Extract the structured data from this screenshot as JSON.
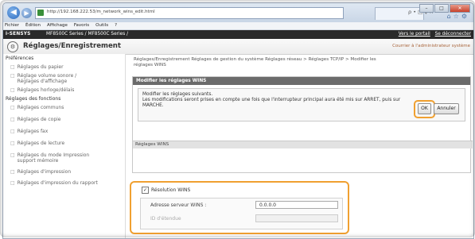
{
  "browser": {
    "url": "http://192.168.222.53/m_network_wins_edit.html",
    "search_controls": "ρ • □ ¢ ×",
    "nav_icons": [
      "arrow-left-icon",
      "arrow-right-icon"
    ],
    "toolbar_icons": [
      "home-icon",
      "star-icon",
      "gear-icon"
    ],
    "menu": [
      "Fichier",
      "Édition",
      "Affichage",
      "Favoris",
      "Outils",
      "?"
    ]
  },
  "device_header": {
    "logo": "i-SENSYS",
    "device": "MF8500C Series / MF8500C Series /",
    "portal_link": "Vers le portail",
    "logout_link": "Se déconnecter"
  },
  "page_header": {
    "title": "Réglages/Enregistrement",
    "admin_link": "Courrier à l'administrateur système"
  },
  "sidebar": {
    "items": [
      {
        "type": "head",
        "label": "Préférences"
      },
      {
        "type": "sub",
        "label": "Réglages du papier"
      },
      {
        "type": "sub",
        "label": "Réglage volume sonore /",
        "label2": "Réglages d'affichage"
      },
      {
        "type": "sub",
        "label": "Réglages horloge/délais"
      },
      {
        "type": "head",
        "label": "Réglages des fonctions"
      },
      {
        "type": "sub",
        "label": "Réglages communs"
      },
      {
        "type": "sub",
        "label": "Réglages de copie"
      },
      {
        "type": "sub",
        "label": "Réglages fax"
      },
      {
        "type": "sub",
        "label": "Réglages de lecture"
      },
      {
        "type": "sub",
        "label": "Réglages du mode Impression",
        "label2": "support mémoire"
      },
      {
        "type": "sub",
        "label": "Réglages d'impression"
      },
      {
        "type": "sub",
        "label": "Réglages d'impression du rapport"
      }
    ]
  },
  "main": {
    "breadcrumb_line1": "Réglages/Enregistrement Réglages de gestion du système Réglages réseau > Réglages TCP/IP > Modifier les",
    "breadcrumb_line2": "réglages WINS",
    "panel_title": "Modifier les réglages WINS",
    "message_line1": "Modifier les réglages suivants.",
    "message_line2": "Les modifications seront prises en compte une fois que l'interrupteur principal aura été mis sur ARRET, puis sur",
    "message_line3": "MARCHE.",
    "ok_label": "OK",
    "cancel_label": "Annuler",
    "section_title": "Réglages WINS",
    "wins_resolution_label": "Résolution WINS",
    "wins_resolution_checked": true,
    "wins_checkbox_mark": "✓",
    "server_address_label": "Adresse serveur WINS :",
    "server_address_value": "0.0.0.0",
    "scope_id_label": "ID d'étendue",
    "scope_id_value": ""
  },
  "colors": {
    "highlight": "#f0a030",
    "header_dark": "#2a2a2a",
    "panel_head": "#6b6b6b"
  }
}
